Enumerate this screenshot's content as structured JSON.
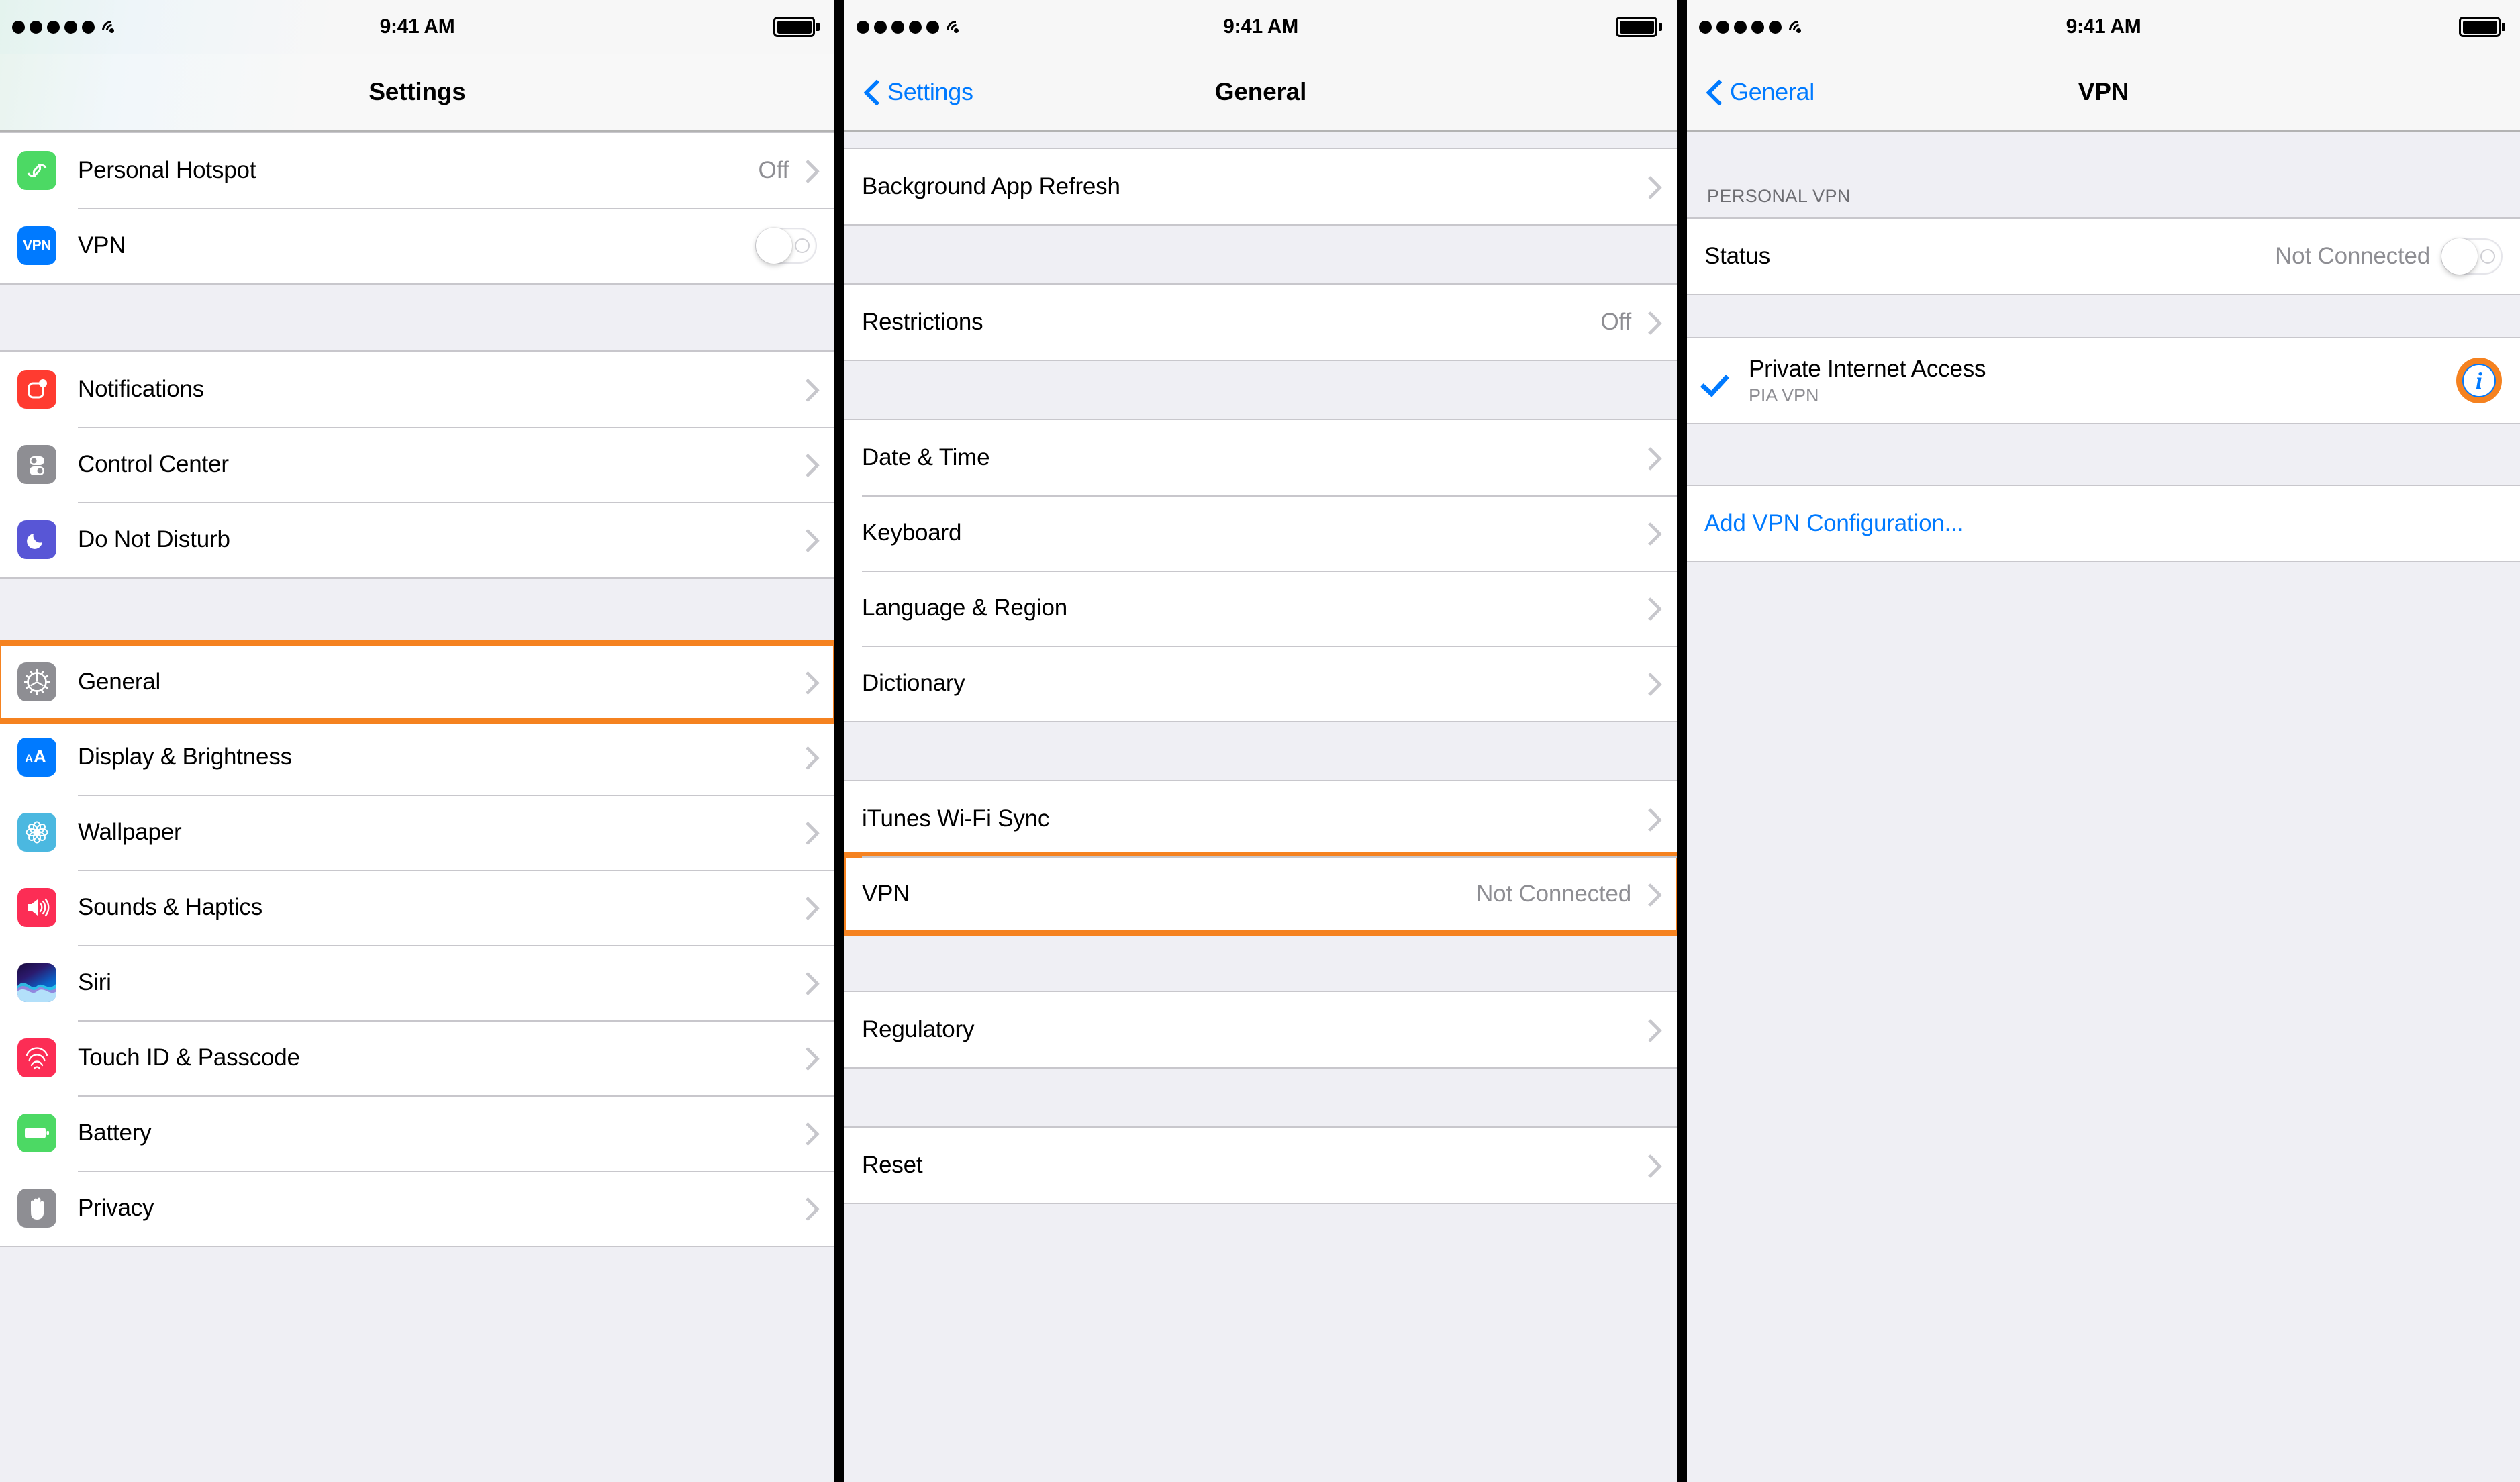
{
  "statusbar": {
    "time": "9:41 AM",
    "signal_dots": 5,
    "wifi_icon": "wifi-icon",
    "battery_icon": "battery-full-icon"
  },
  "panel1": {
    "title": "Settings",
    "groups": [
      {
        "rows": [
          {
            "icon": "personal-hotspot-icon",
            "label": "Personal Hotspot",
            "value": "Off",
            "accessory": "chevron"
          },
          {
            "icon": "vpn-icon",
            "label": "VPN",
            "value": "",
            "accessory": "toggle-off"
          }
        ]
      },
      {
        "rows": [
          {
            "icon": "notifications-icon",
            "label": "Notifications",
            "value": "",
            "accessory": "chevron"
          },
          {
            "icon": "control-center-icon",
            "label": "Control Center",
            "value": "",
            "accessory": "chevron"
          },
          {
            "icon": "do-not-disturb-icon",
            "label": "Do Not Disturb",
            "value": "",
            "accessory": "chevron"
          }
        ]
      },
      {
        "rows": [
          {
            "icon": "general-gear-icon",
            "label": "General",
            "value": "",
            "accessory": "chevron",
            "highlighted": true
          },
          {
            "icon": "display-brightness-icon",
            "label": "Display & Brightness",
            "value": "",
            "accessory": "chevron"
          },
          {
            "icon": "wallpaper-icon",
            "label": "Wallpaper",
            "value": "",
            "accessory": "chevron"
          },
          {
            "icon": "sounds-haptics-icon",
            "label": "Sounds & Haptics",
            "value": "",
            "accessory": "chevron"
          },
          {
            "icon": "siri-icon",
            "label": "Siri",
            "value": "",
            "accessory": "chevron"
          },
          {
            "icon": "touch-id-icon",
            "label": "Touch ID & Passcode",
            "value": "",
            "accessory": "chevron"
          },
          {
            "icon": "battery-icon",
            "label": "Battery",
            "value": "",
            "accessory": "chevron"
          },
          {
            "icon": "privacy-hand-icon",
            "label": "Privacy",
            "value": "",
            "accessory": "chevron"
          }
        ]
      }
    ]
  },
  "panel2": {
    "title": "General",
    "back_label": "Settings",
    "groups": [
      {
        "rows": [
          {
            "label": "Background App Refresh",
            "value": "",
            "accessory": "chevron"
          }
        ]
      },
      {
        "rows": [
          {
            "label": "Restrictions",
            "value": "Off",
            "accessory": "chevron"
          }
        ]
      },
      {
        "rows": [
          {
            "label": "Date & Time",
            "value": "",
            "accessory": "chevron"
          },
          {
            "label": "Keyboard",
            "value": "",
            "accessory": "chevron"
          },
          {
            "label": "Language & Region",
            "value": "",
            "accessory": "chevron"
          },
          {
            "label": "Dictionary",
            "value": "",
            "accessory": "chevron"
          }
        ]
      },
      {
        "rows": [
          {
            "label": "iTunes Wi-Fi Sync",
            "value": "",
            "accessory": "chevron"
          },
          {
            "label": "VPN",
            "value": "Not Connected",
            "accessory": "chevron",
            "highlighted": true
          }
        ]
      },
      {
        "rows": [
          {
            "label": "Regulatory",
            "value": "",
            "accessory": "chevron"
          }
        ]
      },
      {
        "rows": [
          {
            "label": "Reset",
            "value": "",
            "accessory": "chevron"
          }
        ]
      }
    ]
  },
  "panel3": {
    "title": "VPN",
    "back_label": "General",
    "section_header": "PERSONAL VPN",
    "status_row": {
      "label": "Status",
      "value": "Not Connected",
      "accessory": "toggle-off"
    },
    "config_row": {
      "name": "Private Internet Access",
      "subtitle": "PIA VPN",
      "checked": true,
      "info_icon": "info-circle-icon"
    },
    "add_config_label": "Add VPN Configuration..."
  },
  "colors": {
    "accent_blue": "#007aff",
    "highlight_orange": "#f58220",
    "value_gray": "#8e8e93",
    "separator": "#c8c7cc",
    "group_bg": "#efeff4"
  }
}
